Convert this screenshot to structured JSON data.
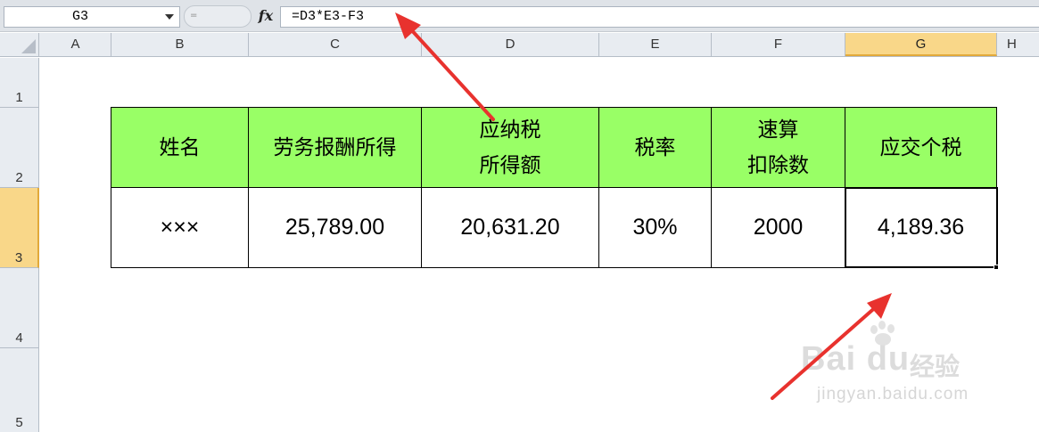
{
  "formula_bar": {
    "name_box_value": "G3",
    "fx_label": "fx",
    "formula": "=D3*E3-F3"
  },
  "columns": [
    "A",
    "B",
    "C",
    "D",
    "E",
    "F",
    "G",
    "H"
  ],
  "active_column": "G",
  "rows": [
    "1",
    "2",
    "3",
    "4",
    "5"
  ],
  "active_row": "3",
  "table": {
    "headers": {
      "name": "姓名",
      "labor_income": "劳务报酬所得",
      "taxable_line1": "应纳税",
      "taxable_line2": "所得额",
      "tax_rate": "税率",
      "quick_deduction_line1": "速算",
      "quick_deduction_line2": "扣除数",
      "tax_payable": "应交个税"
    },
    "row": {
      "name": "×××",
      "labor_income": "25,789.00",
      "taxable_amount": "20,631.20",
      "tax_rate": "30%",
      "quick_deduction": "2000",
      "tax_payable": "4,189.36"
    },
    "header_fill": "#99ff66"
  },
  "colors": {
    "arrow": "#e8322e",
    "active_header": "#f9d789"
  },
  "watermark": {
    "brand": "Bai du",
    "product": "经验",
    "url": "jingyan.baidu.com"
  }
}
